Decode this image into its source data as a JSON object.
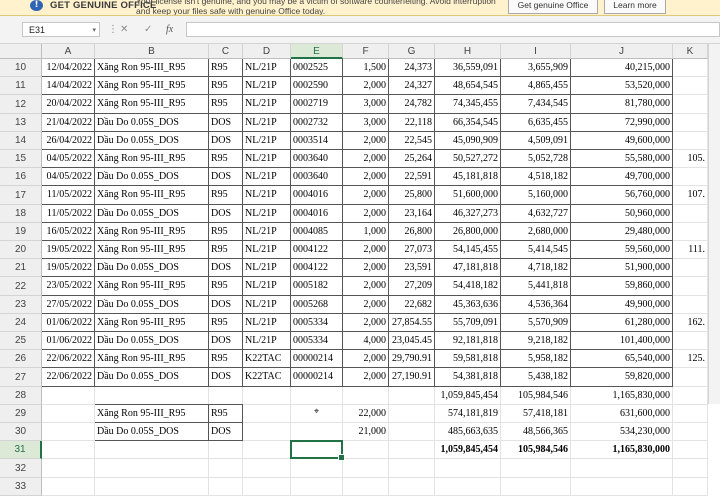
{
  "banner": {
    "title": "GET GENUINE OFFICE",
    "message": "Your license isn't genuine, and you may be a victim of software counterfeiting. Avoid interruption and keep your files safe with genuine Office today.",
    "get_button": "Get genuine Office",
    "learn_button": "Learn more",
    "warn_glyph": "!"
  },
  "formula_bar": {
    "name_box": "E31",
    "name_dropdown": "▾",
    "more_glyph": "⋮",
    "cancel_glyph": "✕",
    "enter_glyph": "✓",
    "fx_glyph": "fx",
    "formula": ""
  },
  "columns": [
    "A",
    "B",
    "C",
    "D",
    "E",
    "F",
    "G",
    "H",
    "I",
    "J",
    "K"
  ],
  "selected_cell": "E31",
  "rows": [
    {
      "n": "10",
      "a": "12/04/2022",
      "b": "Xăng Ron 95-III_R95",
      "c": "R95",
      "d": "NL/21P",
      "e": "0002525",
      "f": "1,500",
      "g": "24,373",
      "h": "36,559,091",
      "i": "3,655,909",
      "j": "40,215,000",
      "k": ""
    },
    {
      "n": "11",
      "a": "14/04/2022",
      "b": "Xăng Ron 95-III_R95",
      "c": "R95",
      "d": "NL/21P",
      "e": "0002590",
      "f": "2,000",
      "g": "24,327",
      "h": "48,654,545",
      "i": "4,865,455",
      "j": "53,520,000",
      "k": ""
    },
    {
      "n": "12",
      "a": "20/04/2022",
      "b": "Xăng Ron 95-III_R95",
      "c": "R95",
      "d": "NL/21P",
      "e": "0002719",
      "f": "3,000",
      "g": "24,782",
      "h": "74,345,455",
      "i": "7,434,545",
      "j": "81,780,000",
      "k": ""
    },
    {
      "n": "13",
      "a": "21/04/2022",
      "b": "Dầu Do 0.05S_DOS",
      "c": "DOS",
      "d": "NL/21P",
      "e": "0002732",
      "f": "3,000",
      "g": "22,118",
      "h": "66,354,545",
      "i": "6,635,455",
      "j": "72,990,000",
      "k": ""
    },
    {
      "n": "14",
      "a": "26/04/2022",
      "b": "Dầu Do 0.05S_DOS",
      "c": "DOS",
      "d": "NL/21P",
      "e": "0003514",
      "f": "2,000",
      "g": "22,545",
      "h": "45,090,909",
      "i": "4,509,091",
      "j": "49,600,000",
      "k": ""
    },
    {
      "n": "15",
      "a": "04/05/2022",
      "b": "Xăng Ron 95-III_R95",
      "c": "R95",
      "d": "NL/21P",
      "e": "0003640",
      "f": "2,000",
      "g": "25,264",
      "h": "50,527,272",
      "i": "5,052,728",
      "j": "55,580,000",
      "k": "105."
    },
    {
      "n": "16",
      "a": "04/05/2022",
      "b": "Dầu Do 0.05S_DOS",
      "c": "DOS",
      "d": "NL/21P",
      "e": "0003640",
      "f": "2,000",
      "g": "22,591",
      "h": "45,181,818",
      "i": "4,518,182",
      "j": "49,700,000",
      "k": ""
    },
    {
      "n": "17",
      "a": "11/05/2022",
      "b": "Xăng Ron 95-III_R95",
      "c": "R95",
      "d": "NL/21P",
      "e": "0004016",
      "f": "2,000",
      "g": "25,800",
      "h": "51,600,000",
      "i": "5,160,000",
      "j": "56,760,000",
      "k": "107."
    },
    {
      "n": "18",
      "a": "11/05/2022",
      "b": "Dầu Do 0.05S_DOS",
      "c": "DOS",
      "d": "NL/21P",
      "e": "0004016",
      "f": "2,000",
      "g": "23,164",
      "h": "46,327,273",
      "i": "4,632,727",
      "j": "50,960,000",
      "k": ""
    },
    {
      "n": "19",
      "a": "16/05/2022",
      "b": "Xăng Ron 95-III_R95",
      "c": "R95",
      "d": "NL/21P",
      "e": "0004085",
      "f": "1,000",
      "g": "26,800",
      "h": "26,800,000",
      "i": "2,680,000",
      "j": "29,480,000",
      "k": ""
    },
    {
      "n": "20",
      "a": "19/05/2022",
      "b": "Xăng Ron 95-III_R95",
      "c": "R95",
      "d": "NL/21P",
      "e": "0004122",
      "f": "2,000",
      "g": "27,073",
      "h": "54,145,455",
      "i": "5,414,545",
      "j": "59,560,000",
      "k": "111."
    },
    {
      "n": "21",
      "a": "19/05/2022",
      "b": "Dầu Do 0.05S_DOS",
      "c": "DOS",
      "d": "NL/21P",
      "e": "0004122",
      "f": "2,000",
      "g": "23,591",
      "h": "47,181,818",
      "i": "4,718,182",
      "j": "51,900,000",
      "k": ""
    },
    {
      "n": "22",
      "a": "23/05/2022",
      "b": "Xăng Ron 95-III_R95",
      "c": "R95",
      "d": "NL/21P",
      "e": "0005182",
      "f": "2,000",
      "g": "27,209",
      "h": "54,418,182",
      "i": "5,441,818",
      "j": "59,860,000",
      "k": ""
    },
    {
      "n": "23",
      "a": "27/05/2022",
      "b": "Dầu Do 0.05S_DOS",
      "c": "DOS",
      "d": "NL/21P",
      "e": "0005268",
      "f": "2,000",
      "g": "22,682",
      "h": "45,363,636",
      "i": "4,536,364",
      "j": "49,900,000",
      "k": ""
    },
    {
      "n": "24",
      "a": "01/06/2022",
      "b": "Xăng Ron 95-III_R95",
      "c": "R95",
      "d": "NL/21P",
      "e": "0005334",
      "f": "2,000",
      "g": "27,854.55",
      "h": "55,709,091",
      "i": "5,570,909",
      "j": "61,280,000",
      "k": "162."
    },
    {
      "n": "25",
      "a": "01/06/2022",
      "b": "Dầu Do 0.05S_DOS",
      "c": "DOS",
      "d": "NL/21P",
      "e": "0005334",
      "f": "4,000",
      "g": "23,045.45",
      "h": "92,181,818",
      "i": "9,218,182",
      "j": "101,400,000",
      "k": ""
    },
    {
      "n": "26",
      "a": "22/06/2022",
      "b": "Xăng Ron 95-III_R95",
      "c": "R95",
      "d": "K22TAC",
      "e": "00000214",
      "f": "2,000",
      "g": "29,790.91",
      "h": "59,581,818",
      "i": "5,958,182",
      "j": "65,540,000",
      "k": "125."
    },
    {
      "n": "27",
      "a": "22/06/2022",
      "b": "Dầu Do 0.05S_DOS",
      "c": "DOS",
      "d": "K22TAC",
      "e": "00000214",
      "f": "2,000",
      "g": "27,190.91",
      "h": "54,381,818",
      "i": "5,438,182",
      "j": "59,820,000",
      "k": ""
    },
    {
      "n": "28",
      "a": "",
      "b": "",
      "c": "",
      "d": "",
      "e": "",
      "f": "",
      "g": "",
      "h": "1,059,845,454",
      "i": "105,984,546",
      "j": "1,165,830,000",
      "k": ""
    },
    {
      "n": "29",
      "a": "",
      "b": "Xăng Ron 95-III_R95",
      "c": "R95",
      "d": "",
      "e": "",
      "f": "22,000",
      "g": "",
      "h": "574,181,819",
      "i": "57,418,181",
      "j": "631,600,000",
      "k": ""
    },
    {
      "n": "30",
      "a": "",
      "b": "Dầu Do 0.05S_DOS",
      "c": "DOS",
      "d": "",
      "e": "",
      "f": "21,000",
      "g": "",
      "h": "485,663,635",
      "i": "48,566,365",
      "j": "534,230,000",
      "k": ""
    },
    {
      "n": "31",
      "a": "",
      "b": "",
      "c": "",
      "d": "",
      "e": "",
      "f": "",
      "g": "",
      "h": "1,059,845,454",
      "i": "105,984,546",
      "j": "1,165,830,000",
      "k": ""
    },
    {
      "n": "32",
      "a": "",
      "b": "",
      "c": "",
      "d": "",
      "e": "",
      "f": "",
      "g": "",
      "h": "",
      "i": "",
      "j": "",
      "k": ""
    },
    {
      "n": "33",
      "a": "",
      "b": "",
      "c": "",
      "d": "",
      "e": "",
      "f": "",
      "g": "",
      "h": "",
      "i": "",
      "j": "",
      "k": ""
    }
  ]
}
